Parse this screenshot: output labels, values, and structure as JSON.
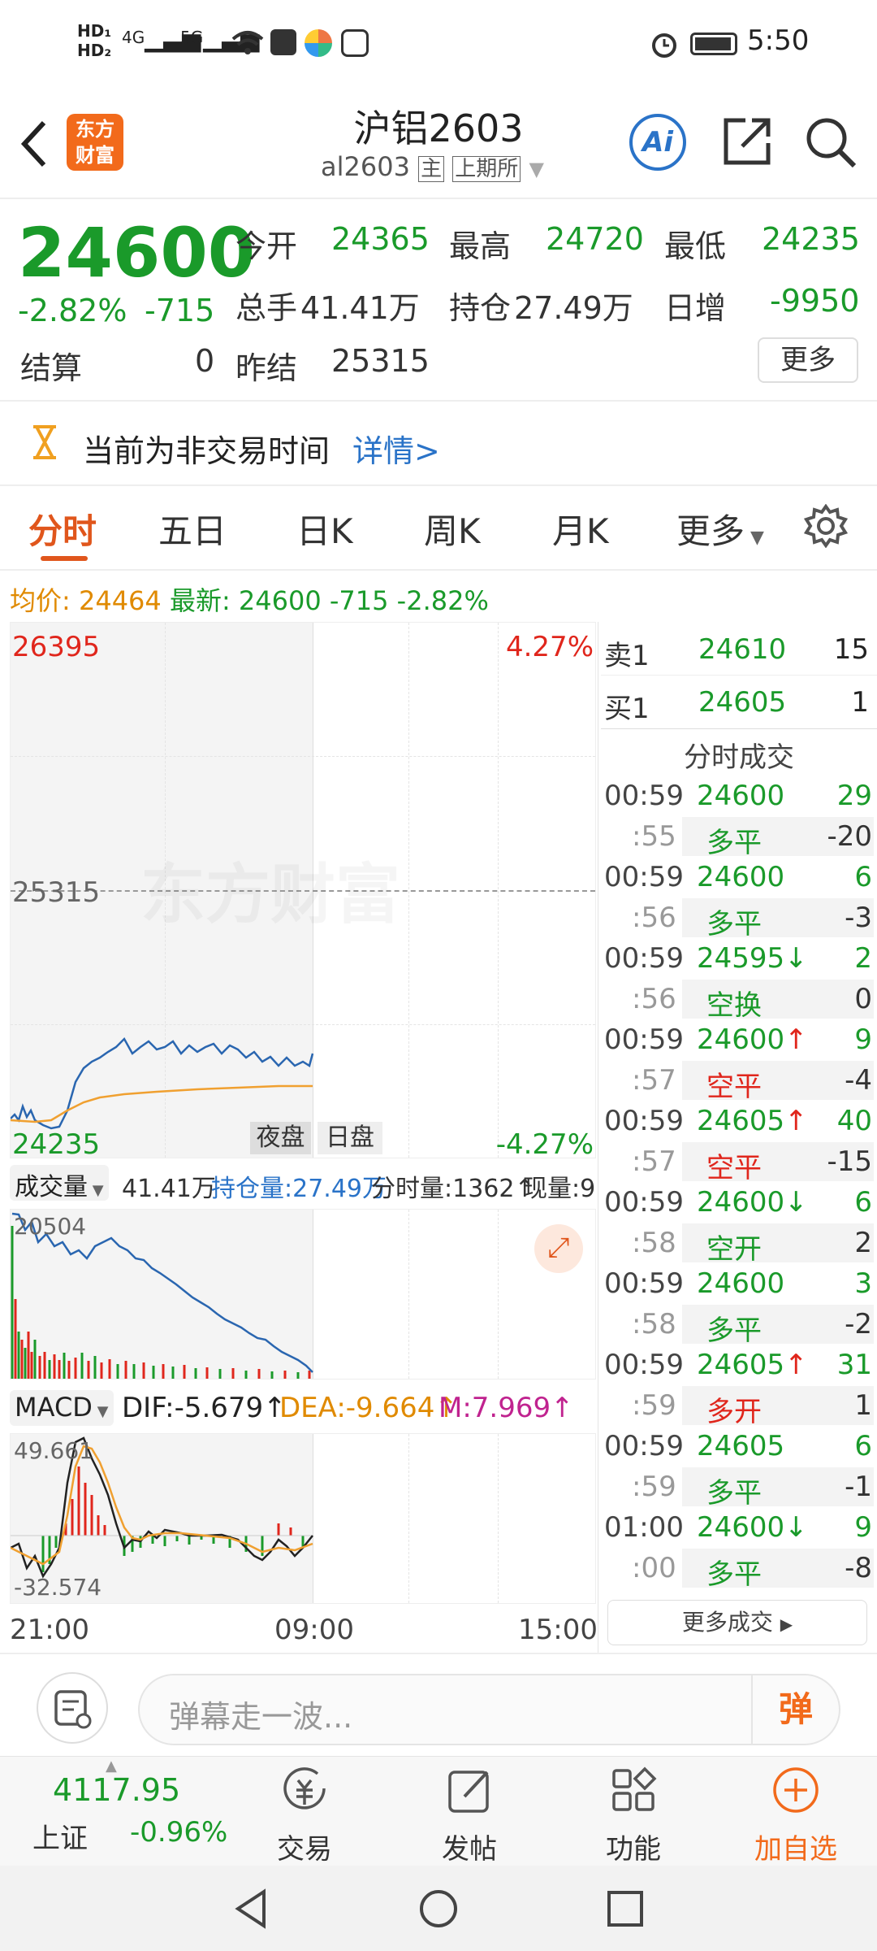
{
  "status_bar": {
    "time": "5:50",
    "net1": "4G",
    "net2": "5G"
  },
  "header": {
    "logo_text": "东方财富",
    "title": "沪铝2603",
    "code": "al2603",
    "badge_main": "主",
    "badge_exchange": "上期所",
    "ai_label": "Ai"
  },
  "quote": {
    "price": "24600",
    "change_pct": "-2.82%",
    "change": "-715",
    "open_label": "今开",
    "open": "24365",
    "high_label": "最高",
    "high": "24720",
    "low_label": "最低",
    "low": "24235",
    "volume_label": "总手",
    "volume": "41.41万",
    "oi_label": "持仓",
    "oi": "27.49万",
    "daily_inc_label": "日增",
    "daily_inc": "-9950",
    "settle_label": "结算",
    "settle": "0",
    "prev_settle_label": "昨结",
    "prev_settle": "25315",
    "more_button": "更多"
  },
  "notice": {
    "text": "当前为非交易时间",
    "link": "详情>"
  },
  "tabs": [
    "分时",
    "五日",
    "日K",
    "周K",
    "月K",
    "更多"
  ],
  "info_line": {
    "avg_label": "均价:",
    "avg": "24464",
    "latest_label": "最新:",
    "latest": "24600",
    "change": "-715",
    "change_pct": "-2.82%"
  },
  "chart_labels": {
    "top_price": "26395",
    "top_pct": "4.27%",
    "mid_price": "25315",
    "bottom_price": "24235",
    "bottom_pct": "-4.27%",
    "night_session": "夜盘",
    "day_session": "日盘",
    "watermark": "东方财富",
    "x_ticks": [
      "21:00",
      "09:00",
      "15:00"
    ]
  },
  "volume_bar": {
    "selector": "成交量",
    "volume": "41.41万",
    "oi": "持仓量:27.49万",
    "tick_volume": "分时量:1362↑",
    "current": "现量:9",
    "max_label": "20504"
  },
  "macd_bar": {
    "selector": "MACD",
    "dif": "DIF:-5.679↑",
    "dea": "DEA:-9.664↑",
    "m": "M:7.969↑",
    "max_label": "49.661",
    "min_label": "-32.574"
  },
  "order_book": [
    {
      "label": "卖1",
      "price": "24610",
      "qty": "15"
    },
    {
      "label": "买1",
      "price": "24605",
      "qty": "1"
    }
  ],
  "trades_title": "分时成交",
  "trades": [
    {
      "time": "00:59",
      "price": "24600",
      "qty": "29",
      "sec": ":55",
      "type": "多平",
      "change": "-20",
      "pc": "green",
      "tc": "green",
      "arrow": ""
    },
    {
      "time": "00:59",
      "price": "24600",
      "qty": "6",
      "sec": ":56",
      "type": "多平",
      "change": "-3",
      "pc": "green",
      "tc": "green",
      "arrow": ""
    },
    {
      "time": "00:59",
      "price": "24595↓",
      "qty": "2",
      "sec": ":56",
      "type": "空换",
      "change": "0",
      "pc": "green",
      "tc": "green",
      "arrow": ""
    },
    {
      "time": "00:59",
      "price": "24600↑",
      "qty": "9",
      "sec": ":57",
      "type": "空平",
      "change": "-4",
      "pc": "green",
      "tc": "red",
      "arrow": ""
    },
    {
      "time": "00:59",
      "price": "24605↑",
      "qty": "40",
      "sec": ":57",
      "type": "空平",
      "change": "-15",
      "pc": "green",
      "tc": "red",
      "arrow": ""
    },
    {
      "time": "00:59",
      "price": "24600↓",
      "qty": "6",
      "sec": ":58",
      "type": "空开",
      "change": "2",
      "pc": "green",
      "tc": "green",
      "arrow": ""
    },
    {
      "time": "00:59",
      "price": "24600",
      "qty": "3",
      "sec": ":58",
      "type": "多平",
      "change": "-2",
      "pc": "green",
      "tc": "green",
      "arrow": ""
    },
    {
      "time": "00:59",
      "price": "24605↑",
      "qty": "31",
      "sec": ":59",
      "type": "多开",
      "change": "1",
      "pc": "green",
      "tc": "red",
      "arrow": ""
    },
    {
      "time": "00:59",
      "price": "24605",
      "qty": "6",
      "sec": ":59",
      "type": "多平",
      "change": "-1",
      "pc": "green",
      "tc": "green",
      "arrow": ""
    },
    {
      "time": "01:00",
      "price": "24600↓",
      "qty": "9",
      "sec": ":00",
      "type": "多平",
      "change": "-8",
      "pc": "green",
      "tc": "green",
      "arrow": ""
    }
  ],
  "more_trades": "更多成交",
  "comment_input": {
    "placeholder": "弹幕走一波...",
    "button": "弹"
  },
  "bottom_nav": {
    "index_value": "4117.95",
    "index_name": "上证",
    "index_change": "-0.96%",
    "items": [
      "交易",
      "发帖",
      "功能",
      "加自选"
    ]
  },
  "colors": {
    "green": "#1a9a2a",
    "red": "#e0261c",
    "orange": "#e08a00",
    "blue": "#2a73c8",
    "accent": "#f26a1b"
  }
}
